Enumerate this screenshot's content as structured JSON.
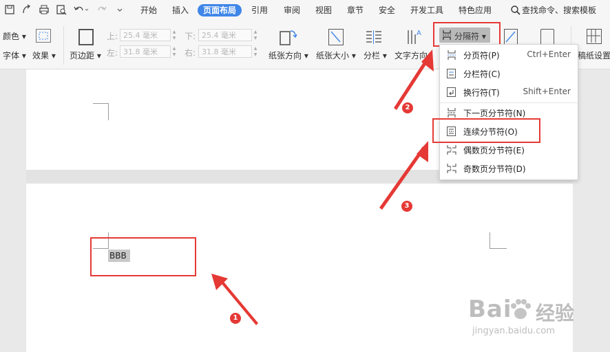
{
  "menubar": {
    "tabs": [
      "开始",
      "插入",
      "页面布局",
      "引用",
      "审阅",
      "视图",
      "章节",
      "安全",
      "开发工具",
      "特色应用"
    ],
    "active_tab": "页面布局",
    "search": "查找命令、搜索模板"
  },
  "ribbon": {
    "color_label": "颜色",
    "font_label": "字体",
    "effect_label": "效果",
    "margins_label": "页边距",
    "top_label": "上:",
    "top_value": "25.4 毫米",
    "bottom_label": "下:",
    "bottom_value": "25.4 毫米",
    "left_label": "左:",
    "left_value": "31.8 毫米",
    "right_label": "右:",
    "right_value": "31.8 毫米",
    "orientation_label": "纸张方向",
    "size_label": "纸张大小",
    "columns_label": "分栏",
    "text_direction_label": "文字方向",
    "breaks_label": "分隔符",
    "manuscript_label": "稿纸设置"
  },
  "dropdown": {
    "items": [
      {
        "label": "分页符(P)",
        "shortcut": "Ctrl+Enter"
      },
      {
        "label": "分栏符(C)",
        "shortcut": ""
      },
      {
        "label": "换行符(T)",
        "shortcut": "Shift+Enter"
      },
      {
        "label": "下一页分节符(N)",
        "shortcut": ""
      },
      {
        "label": "连续分节符(O)",
        "shortcut": ""
      },
      {
        "label": "偶数页分节符(E)",
        "shortcut": ""
      },
      {
        "label": "奇数页分节符(D)",
        "shortcut": ""
      }
    ]
  },
  "document": {
    "selected_text": "BBB"
  },
  "annotations": {
    "step1": "1",
    "step2": "2",
    "step3": "3",
    "color": "#e53935"
  },
  "watermark": {
    "brand": "Bai",
    "brand_cn": "经验",
    "url": "jingyan.baidu.com"
  }
}
